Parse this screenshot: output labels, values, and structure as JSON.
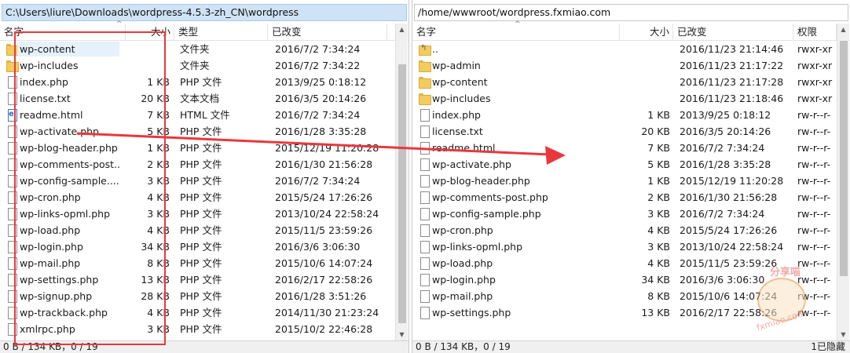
{
  "left": {
    "path": "C:\\Users\\liure\\Downloads\\wordpress-4.5.3-zh_CN\\wordpress",
    "columns": {
      "name": "名字",
      "size": "大小",
      "type": "类型",
      "modified": "已改变"
    },
    "rows": [
      {
        "name": "wp-content",
        "size": "",
        "type": "文件夹",
        "modified": "2016/7/2  7:34:24",
        "icon": "folder"
      },
      {
        "name": "wp-includes",
        "size": "",
        "type": "文件夹",
        "modified": "2016/7/2  7:34:22",
        "icon": "folder"
      },
      {
        "name": "index.php",
        "size": "1 KB",
        "type": "PHP 文件",
        "modified": "2013/9/25  0:18:12",
        "icon": "file"
      },
      {
        "name": "license.txt",
        "size": "20 KB",
        "type": "文本文档",
        "modified": "2016/3/5  20:14:26",
        "icon": "file"
      },
      {
        "name": "readme.html",
        "size": "7 KB",
        "type": "HTML 文件",
        "modified": "2016/7/2  7:34:24",
        "icon": "html"
      },
      {
        "name": "wp-activate.php",
        "size": "5 KB",
        "type": "PHP 文件",
        "modified": "2016/1/28  3:35:28",
        "icon": "file"
      },
      {
        "name": "wp-blog-header.php",
        "size": "1 KB",
        "type": "PHP 文件",
        "modified": "2015/12/19  11:20:28",
        "icon": "file"
      },
      {
        "name": "wp-comments-post...",
        "size": "2 KB",
        "type": "PHP 文件",
        "modified": "2016/1/30  21:56:28",
        "icon": "file"
      },
      {
        "name": "wp-config-sample....",
        "size": "3 KB",
        "type": "PHP 文件",
        "modified": "2016/7/2  7:34:24",
        "icon": "file"
      },
      {
        "name": "wp-cron.php",
        "size": "4 KB",
        "type": "PHP 文件",
        "modified": "2015/5/24  17:26:26",
        "icon": "file"
      },
      {
        "name": "wp-links-opml.php",
        "size": "3 KB",
        "type": "PHP 文件",
        "modified": "2013/10/24  22:58:24",
        "icon": "file"
      },
      {
        "name": "wp-load.php",
        "size": "4 KB",
        "type": "PHP 文件",
        "modified": "2015/11/5  23:59:26",
        "icon": "file"
      },
      {
        "name": "wp-login.php",
        "size": "34 KB",
        "type": "PHP 文件",
        "modified": "2016/3/6  3:06:30",
        "icon": "file"
      },
      {
        "name": "wp-mail.php",
        "size": "8 KB",
        "type": "PHP 文件",
        "modified": "2015/10/6  14:07:24",
        "icon": "file"
      },
      {
        "name": "wp-settings.php",
        "size": "13 KB",
        "type": "PHP 文件",
        "modified": "2016/2/17  22:58:26",
        "icon": "file"
      },
      {
        "name": "wp-signup.php",
        "size": "28 KB",
        "type": "PHP 文件",
        "modified": "2016/1/28  3:51:26",
        "icon": "file"
      },
      {
        "name": "wp-trackback.php",
        "size": "4 KB",
        "type": "PHP 文件",
        "modified": "2014/11/30  21:23:24",
        "icon": "file"
      },
      {
        "name": "xmlrpc.php",
        "size": "3 KB",
        "type": "PHP 文件",
        "modified": "2015/10/2  22:46:28",
        "icon": "file"
      }
    ],
    "status": "0 B / 134 KB，0 / 19"
  },
  "right": {
    "path": "/home/wwwroot/wordpress.fxmiao.com",
    "columns": {
      "name": "名字",
      "size": "大小",
      "modified": "已改变",
      "perms": "权限"
    },
    "rows": [
      {
        "name": "..",
        "size": "",
        "modified": "2016/11/23 21:14:46",
        "perms": "rwxr-xr",
        "icon": "up"
      },
      {
        "name": "wp-admin",
        "size": "",
        "modified": "2016/11/23 21:17:22",
        "perms": "rwxr-xr",
        "icon": "folder"
      },
      {
        "name": "wp-content",
        "size": "",
        "modified": "2016/11/23 21:17:28",
        "perms": "rwxr-xr",
        "icon": "folder"
      },
      {
        "name": "wp-includes",
        "size": "",
        "modified": "2016/11/23 21:18:46",
        "perms": "rwxr-xr",
        "icon": "folder"
      },
      {
        "name": "index.php",
        "size": "1 KB",
        "modified": "2013/9/25 0:18:12",
        "perms": "rw-r--r-",
        "icon": "file"
      },
      {
        "name": "license.txt",
        "size": "20 KB",
        "modified": "2016/3/5 20:14:26",
        "perms": "rw-r--r-",
        "icon": "file"
      },
      {
        "name": "readme.html",
        "size": "7 KB",
        "modified": "2016/7/2 7:34:24",
        "perms": "rw-r--r-",
        "icon": "file"
      },
      {
        "name": "wp-activate.php",
        "size": "5 KB",
        "modified": "2016/1/28 3:35:28",
        "perms": "rw-r--r-",
        "icon": "file"
      },
      {
        "name": "wp-blog-header.php",
        "size": "1 KB",
        "modified": "2015/12/19 11:20:28",
        "perms": "rw-r--r-",
        "icon": "file"
      },
      {
        "name": "wp-comments-post.php",
        "size": "2 KB",
        "modified": "2016/1/30 21:56:28",
        "perms": "rw-r--r-",
        "icon": "file"
      },
      {
        "name": "wp-config-sample.php",
        "size": "3 KB",
        "modified": "2016/7/2 7:34:24",
        "perms": "rw-r--r-",
        "icon": "file"
      },
      {
        "name": "wp-cron.php",
        "size": "4 KB",
        "modified": "2015/5/24 17:26:26",
        "perms": "rw-r--r-",
        "icon": "file"
      },
      {
        "name": "wp-links-opml.php",
        "size": "3 KB",
        "modified": "2013/10/24 22:58:24",
        "perms": "rw-r--r-",
        "icon": "file"
      },
      {
        "name": "wp-load.php",
        "size": "4 KB",
        "modified": "2015/11/5 23:59:26",
        "perms": "rw-r--r-",
        "icon": "file"
      },
      {
        "name": "wp-login.php",
        "size": "34 KB",
        "modified": "2016/3/6 3:06:30",
        "perms": "rw-r--r-",
        "icon": "file"
      },
      {
        "name": "wp-mail.php",
        "size": "8 KB",
        "modified": "2015/10/6 14:07:24",
        "perms": "rw-r--r-",
        "icon": "file"
      },
      {
        "name": "wp-settings.php",
        "size": "13 KB",
        "modified": "2016/2/17 22:58:26",
        "perms": "rw-r--r-",
        "icon": "file"
      }
    ],
    "status": "0 B / 134 KB，0 / 19",
    "status_right": "1已隐藏"
  },
  "watermark": {
    "top_text": "分享喵",
    "url_text": "fxmiao.com"
  },
  "annotation_color": "#e8383d"
}
